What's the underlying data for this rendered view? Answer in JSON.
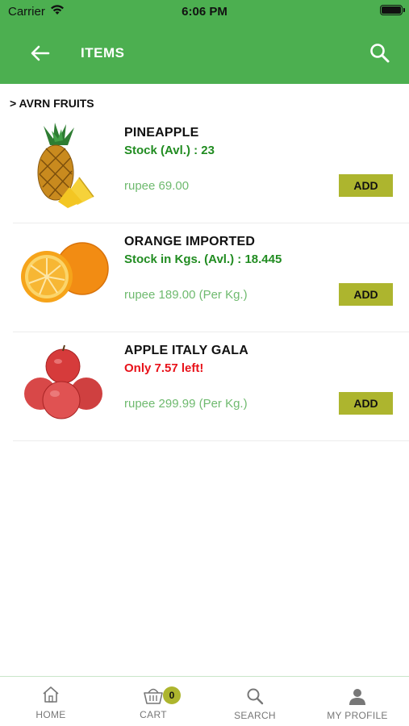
{
  "status_bar": {
    "carrier": "Carrier",
    "time": "6:06 PM"
  },
  "header": {
    "title": "ITEMS"
  },
  "breadcrumb": "> AVRN FRUITS",
  "items": [
    {
      "name": "PINEAPPLE",
      "stock": "Stock (Avl.) : 23",
      "price": "rupee 69.00",
      "add_label": "ADD"
    },
    {
      "name": "ORANGE IMPORTED",
      "stock": "Stock in Kgs. (Avl.) : 18.445",
      "price": "rupee 189.00 (Per Kg.)",
      "add_label": "ADD"
    },
    {
      "name": "APPLE ITALY GALA",
      "stock": "Only 7.57 left!",
      "price": "rupee 299.99 (Per Kg.)",
      "add_label": "ADD"
    }
  ],
  "tabbar": {
    "home": "HOME",
    "cart": "CART",
    "cart_count": "0",
    "search": "SEARCH",
    "profile": "MY PROFILE"
  },
  "colors": {
    "header_green": "#4caf50",
    "stock_green": "#218c21",
    "stock_low_red": "#e8121a",
    "price_green": "#6fba6f",
    "add_button": "#adb52e"
  },
  "icons": [
    "wifi-icon",
    "battery-icon",
    "back-arrow-icon",
    "search-icon",
    "pineapple-image",
    "orange-image",
    "apple-image",
    "home-icon",
    "cart-icon",
    "search-tab-icon",
    "profile-icon"
  ]
}
